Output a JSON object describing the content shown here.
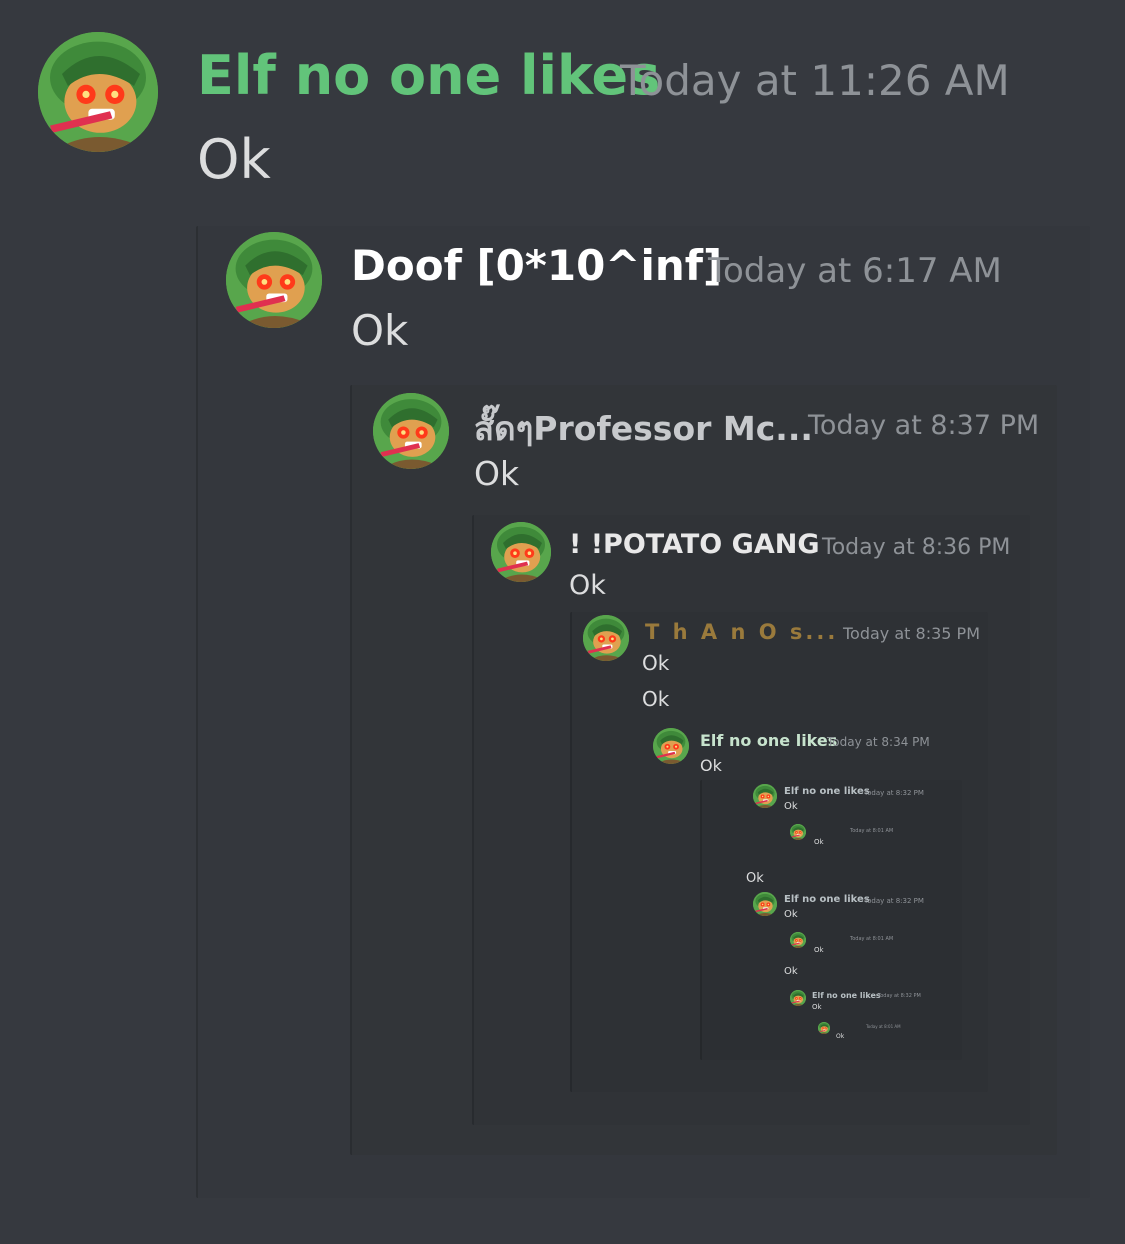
{
  "messages": [
    {
      "author": "Elf no one likes",
      "timestamp": "Today at 11:26 AM",
      "lines": [
        "Ok"
      ],
      "name_color": "#62c47a"
    },
    {
      "author": "Doof [0*10^inf]",
      "timestamp": "Today at 6:17 AM",
      "lines": [
        "Ok"
      ],
      "name_color": "#ffffff"
    },
    {
      "author": "สั๊ดๆProfessor Mc...",
      "timestamp": "Today at 8:37 PM",
      "lines": [
        "Ok"
      ],
      "name_color": "#c7c9cc"
    },
    {
      "author": "! !POTATO GANG",
      "timestamp": "Today at 8:36 PM",
      "lines": [
        "Ok"
      ],
      "name_color": "#e8e8e8"
    },
    {
      "author": "T h A n O s...",
      "timestamp": "Today at 8:35 PM",
      "lines": [
        "Ok",
        "Ok"
      ],
      "name_color": "#9a7a3c"
    },
    {
      "author": "Elf no one likes",
      "timestamp": "Today at 8:34 PM",
      "lines": [
        "Ok"
      ],
      "name_color": "#c7e3cd"
    },
    {
      "author": "Elf no one likes",
      "timestamp": "Today at 8:32 PM",
      "lines": [
        "Ok"
      ],
      "name_color": "#b8c0c4"
    },
    {
      "author": "",
      "timestamp": "Today at 8:01 AM",
      "lines": [
        "Ok"
      ],
      "name_color": "#7a5a48"
    }
  ],
  "stray_ok": [
    "Ok",
    "Ok"
  ],
  "repeat_block": [
    {
      "author": "Elf no one likes",
      "timestamp": "Today at 8:32 PM",
      "lines": [
        "Ok"
      ]
    },
    {
      "author": "",
      "timestamp": "Today at 8:01 AM",
      "lines": [
        "Ok"
      ]
    },
    {
      "author": "Elf no one likes",
      "timestamp": "Today at 8:32 PM",
      "lines": [
        "Ok"
      ]
    },
    {
      "author": "",
      "timestamp": "Today at 8:01 AM",
      "lines": [
        "Ok"
      ]
    }
  ],
  "avatar_icon": "red-eyed-elf-avatar-icon",
  "colors": {
    "background": "#36393f",
    "quote_border": "#2f3136",
    "green_name": "#62c47a"
  }
}
